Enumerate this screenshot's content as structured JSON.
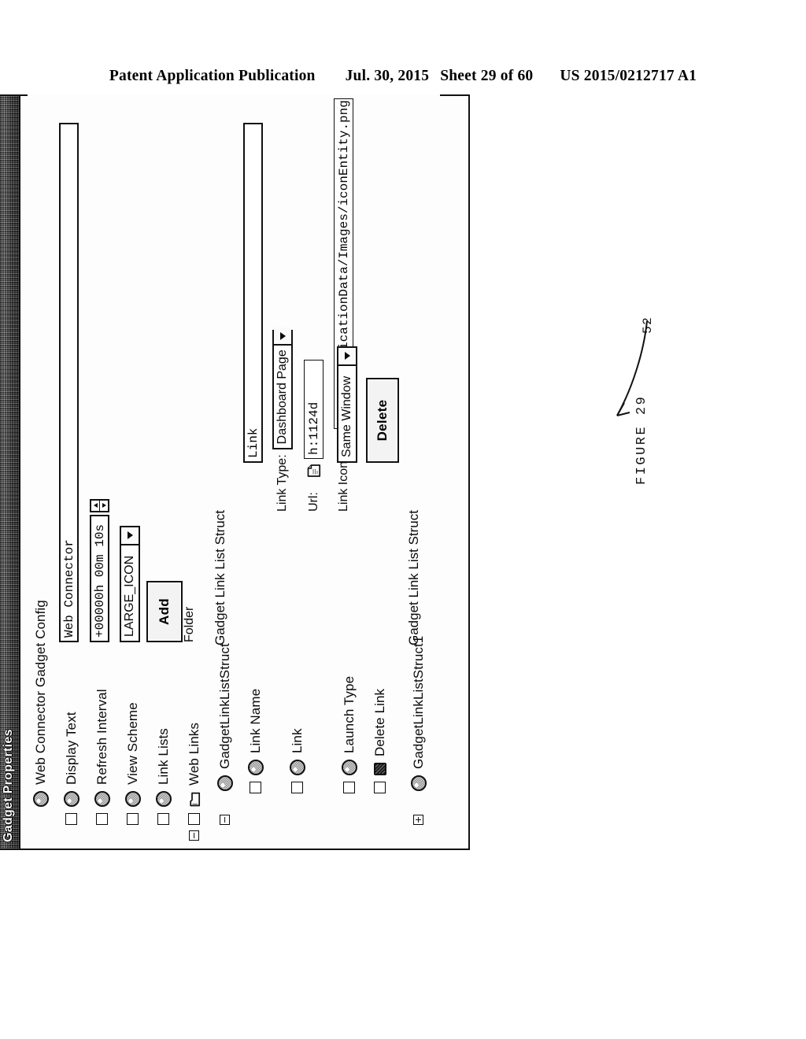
{
  "patent_header": {
    "publication": "Patent Application Publication",
    "date": "Jul. 30, 2015",
    "sheet": "Sheet 29 of 60",
    "number": "US 2015/0212717 A1"
  },
  "figure": {
    "caption": "FIGURE 29",
    "reference_number": "52"
  },
  "dialog": {
    "title": "Gadget Properties",
    "root": {
      "label": "Web Connector Gadget Config",
      "icon": "node-circle-icon"
    },
    "tree": [
      {
        "label": "Display Text",
        "icon": "node-circle-icon",
        "checkbox": true,
        "expander": "none"
      },
      {
        "label": "Refresh Interval",
        "icon": "node-circle-icon",
        "checkbox": true,
        "expander": "none"
      },
      {
        "label": "View Scheme",
        "icon": "node-circle-icon",
        "checkbox": true,
        "expander": "none"
      },
      {
        "label": "Link Lists",
        "icon": "node-circle-icon",
        "checkbox": true,
        "expander": "none"
      },
      {
        "label": "Web Links",
        "icon": "folder-icon",
        "checkbox": true,
        "expander": "minus"
      },
      {
        "label": "GadgetLinkListStruct",
        "icon": "node-circle-icon",
        "checkbox": false,
        "expander": "minus"
      },
      {
        "label": "Link Name",
        "icon": "node-circle-icon",
        "checkbox": true,
        "expander": "none"
      },
      {
        "label": "Link",
        "icon": "node-circle-icon",
        "checkbox": true,
        "expander": "none"
      },
      {
        "label": "Launch Type",
        "icon": "node-circle-icon",
        "checkbox": true,
        "expander": "none"
      },
      {
        "label": "Delete Link",
        "icon": "delete-glyph-icon",
        "checkbox": true,
        "expander": "none"
      },
      {
        "label": "GadgetLinkListStruct1",
        "icon": "node-circle-icon",
        "checkbox": false,
        "expander": "plus"
      }
    ],
    "controls": {
      "display_text": {
        "value": "Web Connector",
        "placeholder": ""
      },
      "refresh_interval": {
        "value": "+00000h 00m 10s",
        "spinner_up": "▲",
        "spinner_down": "▼"
      },
      "view_scheme": {
        "value": "LARGE_ICON"
      },
      "link_lists_add": {
        "label": "Add"
      },
      "web_links_folder": {
        "label": "Folder"
      },
      "struct_section_label": "Gadget Link List Struct",
      "struct1_section_label": "Gadget Link List Struct",
      "link_name": {
        "value": "Link"
      },
      "link_type": {
        "label": "Link Type:",
        "value": "Dashboard Page"
      },
      "url": {
        "label": "Url:",
        "value": "h:1124d",
        "icon": "page-icon"
      },
      "link_icon": {
        "label": "Link Icon:",
        "value": "file:^ApplicationData/Images/iconEntity.png",
        "icon": "page-icon"
      },
      "launch_type": {
        "value": "Same Window"
      },
      "delete_link": {
        "label": "Delete"
      }
    }
  }
}
